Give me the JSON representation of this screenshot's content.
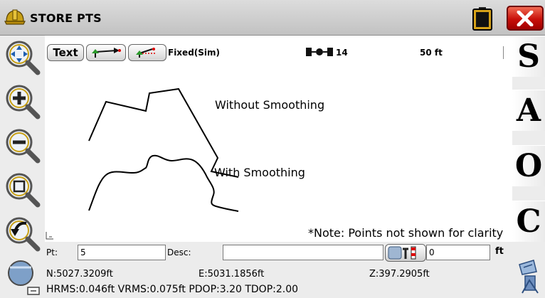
{
  "window": {
    "title": "STORE PTS",
    "app_icon": "hard-hat-icon",
    "battery_icon": "battery-icon",
    "close_icon": "close-x-icon"
  },
  "toolbar": {
    "text_button_label": "Text",
    "gps_status": "Fixed(Sim)",
    "satellite_count": "14",
    "scale": "50 ft"
  },
  "map": {
    "label_without": "Without Smoothing",
    "label_with": "With Smoothing",
    "note": "*Note:  Points not shown for clarity"
  },
  "right_buttons": [
    "S",
    "A",
    "O",
    "C"
  ],
  "left_tools": [
    "pan-zoom-icon",
    "zoom-in-icon",
    "zoom-out-icon",
    "zoom-extents-icon",
    "zoom-previous-icon",
    "zoom-window-icon"
  ],
  "point_entry": {
    "pt_label": "Pt:",
    "pt_value": "5",
    "desc_label": "Desc:",
    "desc_value": "",
    "rod_height": "0",
    "unit": "ft"
  },
  "coordinates": {
    "north": "N:5027.3209ft",
    "east": "E:5031.1856ft",
    "elevation": "Z:397.2905ft",
    "accuracy": "HRMS:0.046ft VRMS:0.075ft PDOP:3.20 TDOP:2.00"
  },
  "colors": {
    "close_button": "#c8100a",
    "chrome": "#ececec"
  }
}
